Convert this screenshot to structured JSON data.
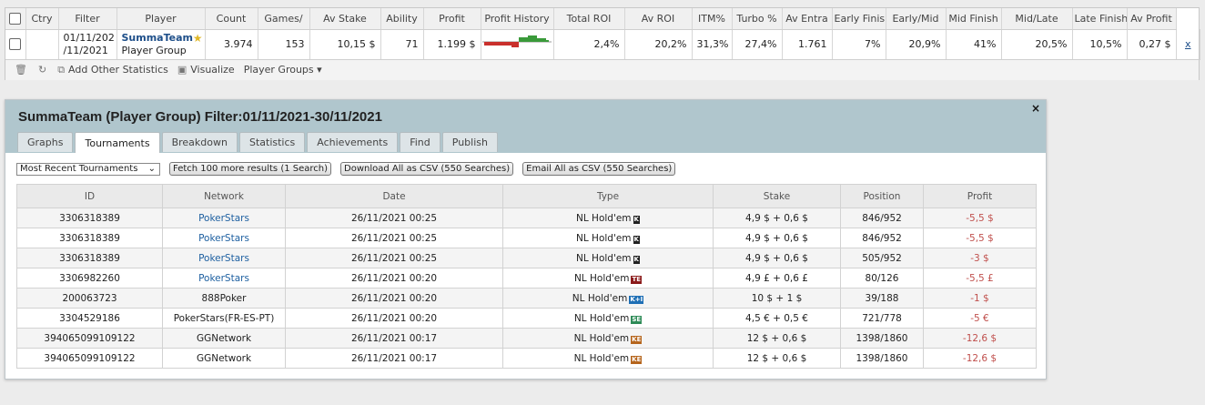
{
  "stats": {
    "headers": [
      "Ctry",
      "Filter",
      "Player",
      "Count",
      "Games/",
      "Av Stake",
      "Ability",
      "Profit",
      "Profit History",
      "Total ROI",
      "Av ROI",
      "ITM%",
      "Turbo %",
      "Av Entra",
      "Early Finis",
      "Early/Mid",
      "Mid Finish",
      "Mid/Late",
      "Late Finishes",
      "Av Profit"
    ],
    "row": {
      "filter_line1": "01/11/202",
      "filter_line2": "/11/2021",
      "player_name": "SummaTeam",
      "player_type": "Player Group",
      "count": "3.974",
      "games": "153",
      "av_stake": "10,15 $",
      "ability": "71",
      "profit": "1.199 $",
      "total_roi": "2,4%",
      "av_roi": "20,2%",
      "itm": "31,3%",
      "turbo": "27,4%",
      "av_entrants": "1.761",
      "early_finishes": "7%",
      "early_mid": "20,9%",
      "mid_finish": "41%",
      "mid_late": "20,5%",
      "late_finishes": "10,5%",
      "av_profit": "0,27 $",
      "remove": "x"
    },
    "toolbar": {
      "add_stats": "Add Other Statistics",
      "visualize": "Visualize",
      "player_groups": "Player Groups"
    }
  },
  "panel": {
    "title": "SummaTeam (Player Group) Filter:01/11/2021-30/11/2021",
    "tabs": [
      "Graphs",
      "Tournaments",
      "Breakdown",
      "Statistics",
      "Achievements",
      "Find",
      "Publish"
    ],
    "active_tab": "Tournaments",
    "select_value": "Most Recent Tournaments",
    "buttons": {
      "fetch": "Fetch 100 more results (1 Search)",
      "download": "Download All as CSV (550 Searches)",
      "email": "Email All as CSV (550 Searches)"
    },
    "columns": [
      "ID",
      "Network",
      "Date",
      "Type",
      "Stake",
      "Position",
      "Profit"
    ],
    "rows": [
      {
        "id": "3306318389",
        "network": "PokerStars",
        "date": "26/11/2021 00:25",
        "type": "NL Hold'em",
        "badge": "K",
        "stake": "4,9 $ + 0,6 $",
        "position": "846/952",
        "profit": "-5,5 $"
      },
      {
        "id": "3306318389",
        "network": "PokerStars",
        "date": "26/11/2021 00:25",
        "type": "NL Hold'em",
        "badge": "K",
        "stake": "4,9 $ + 0,6 $",
        "position": "846/952",
        "profit": "-5,5 $"
      },
      {
        "id": "3306318389",
        "network": "PokerStars",
        "date": "26/11/2021 00:25",
        "type": "NL Hold'em",
        "badge": "K",
        "stake": "4,9 $ + 0,6 $",
        "position": "505/952",
        "profit": "-3 $"
      },
      {
        "id": "3306982260",
        "network": "PokerStars",
        "date": "26/11/2021 00:20",
        "type": "NL Hold'em",
        "badge": "TE",
        "stake": "4,9 £ + 0,6 £",
        "position": "80/126",
        "profit": "-5,5 £"
      },
      {
        "id": "200063723",
        "network": "888Poker",
        "date": "26/11/2021 00:20",
        "type": "NL Hold'em",
        "badge": "K+I",
        "stake": "10 $ + 1 $",
        "position": "39/188",
        "profit": "-1 $"
      },
      {
        "id": "3304529186",
        "network": "PokerStars(FR-ES-PT)",
        "date": "26/11/2021 00:20",
        "type": "NL Hold'em",
        "badge": "SE",
        "stake": "4,5 € + 0,5 €",
        "position": "721/778",
        "profit": "-5 €"
      },
      {
        "id": "394065099109122",
        "network": "GGNetwork",
        "date": "26/11/2021 00:17",
        "type": "NL Hold'em",
        "badge": "KE",
        "stake": "12 $ + 0,6 $",
        "position": "1398/1860",
        "profit": "-12,6 $"
      },
      {
        "id": "394065099109122",
        "network": "GGNetwork",
        "date": "26/11/2021 00:17",
        "type": "NL Hold'em",
        "badge": "KE",
        "stake": "12 $ + 0,6 $",
        "position": "1398/1860",
        "profit": "-12,6 $"
      }
    ],
    "close": "×"
  },
  "colors": {
    "panel_header": "#b0c6cd",
    "link": "#1d5fa0",
    "negative": "#c0504d"
  }
}
